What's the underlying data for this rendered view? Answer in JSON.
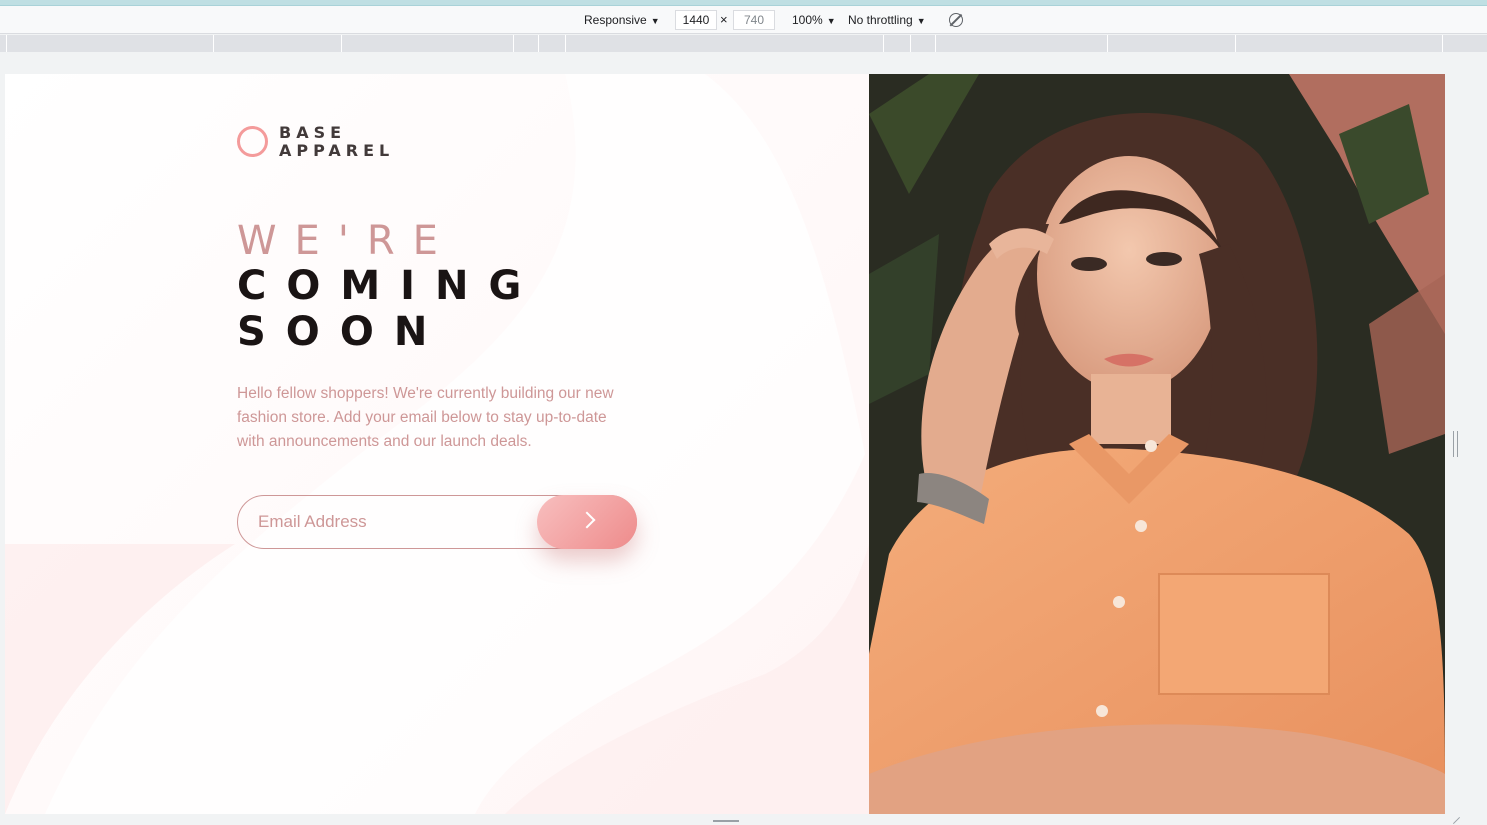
{
  "devtools": {
    "device_label": "Responsive",
    "width_value": "1440",
    "height_value": "740",
    "times_sign": "×",
    "zoom_label": "100%",
    "throttle_label": "No throttling"
  },
  "site": {
    "logo_text_line1": "BASE",
    "logo_text_line2": "APPAREL",
    "heading_light": "WE'RE",
    "heading_bold_1": "COMING",
    "heading_bold_2": "SOON",
    "description": "Hello fellow shoppers! We're currently building our new fashion store. Add your email below to stay up-to-date with announcements and our launch deals.",
    "email_placeholder": "Email Address",
    "email_value": ""
  },
  "colors": {
    "accent_pink": "#f49b9b",
    "desaturated_red": "#ce9797",
    "dark_grayish_red": "#423a3a",
    "shirt_orange": "#f0a070"
  },
  "icons": {
    "submit": "chevron-right-icon",
    "logo": "circle-logo-icon",
    "rotate": "rotate-icon"
  }
}
